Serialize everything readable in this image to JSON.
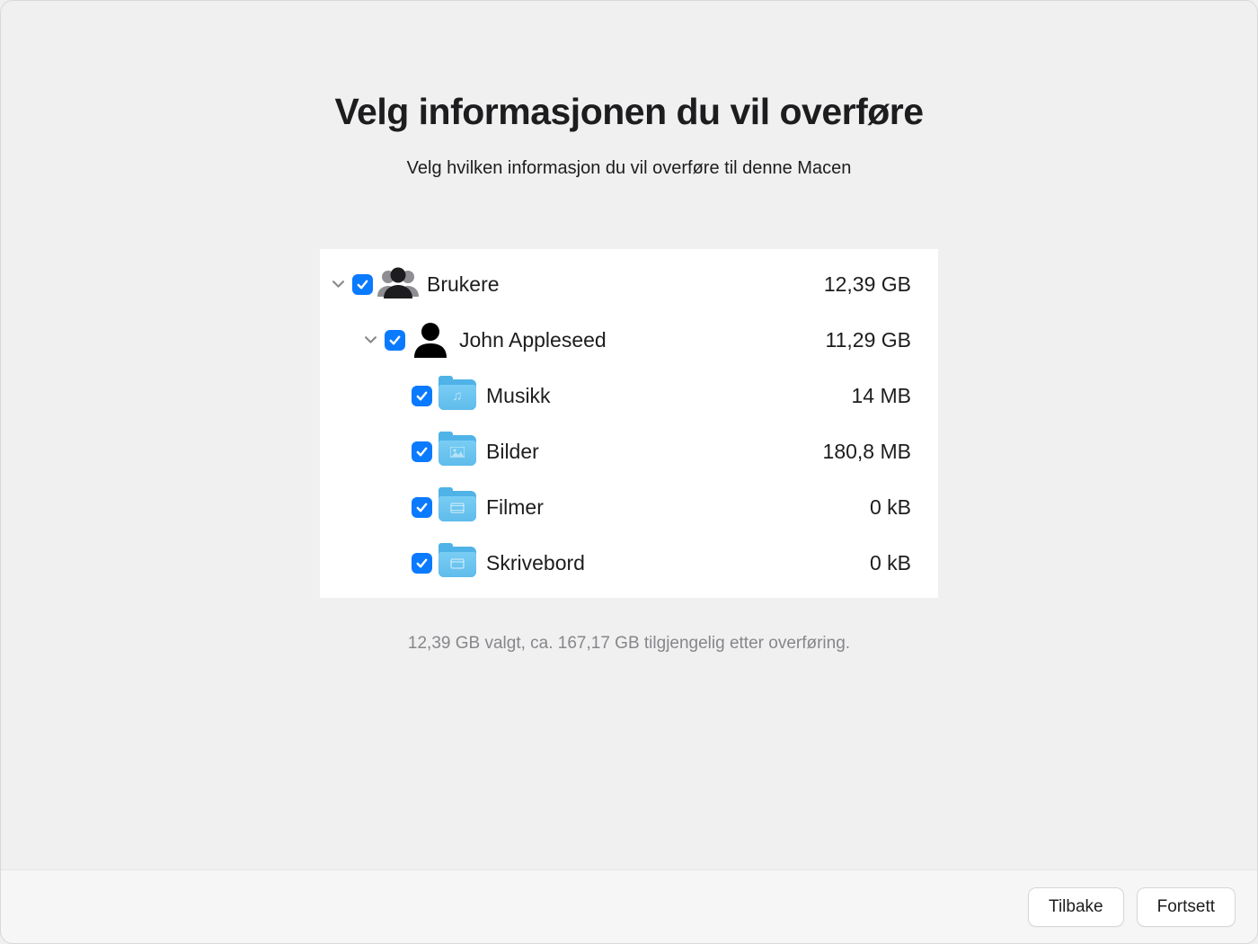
{
  "title": "Velg informasjonen du vil overføre",
  "subtitle": "Velg hvilken informasjon du vil overføre til denne Macen",
  "tree": {
    "users": {
      "label": "Brukere",
      "size": "12,39 GB"
    },
    "user1": {
      "label": "John Appleseed",
      "size": "11,29 GB"
    },
    "music": {
      "label": "Musikk",
      "size": "14 MB"
    },
    "pictures": {
      "label": "Bilder",
      "size": "180,8 MB"
    },
    "movies": {
      "label": "Filmer",
      "size": "0 kB"
    },
    "desktop": {
      "label": "Skrivebord",
      "size": "0 kB"
    }
  },
  "status": "12,39 GB valgt, ca. 167,17 GB tilgjengelig etter overføring.",
  "buttons": {
    "back": "Tilbake",
    "continue": "Fortsett"
  },
  "colors": {
    "accent": "#0a7aff",
    "folder": "#5fbceb"
  }
}
